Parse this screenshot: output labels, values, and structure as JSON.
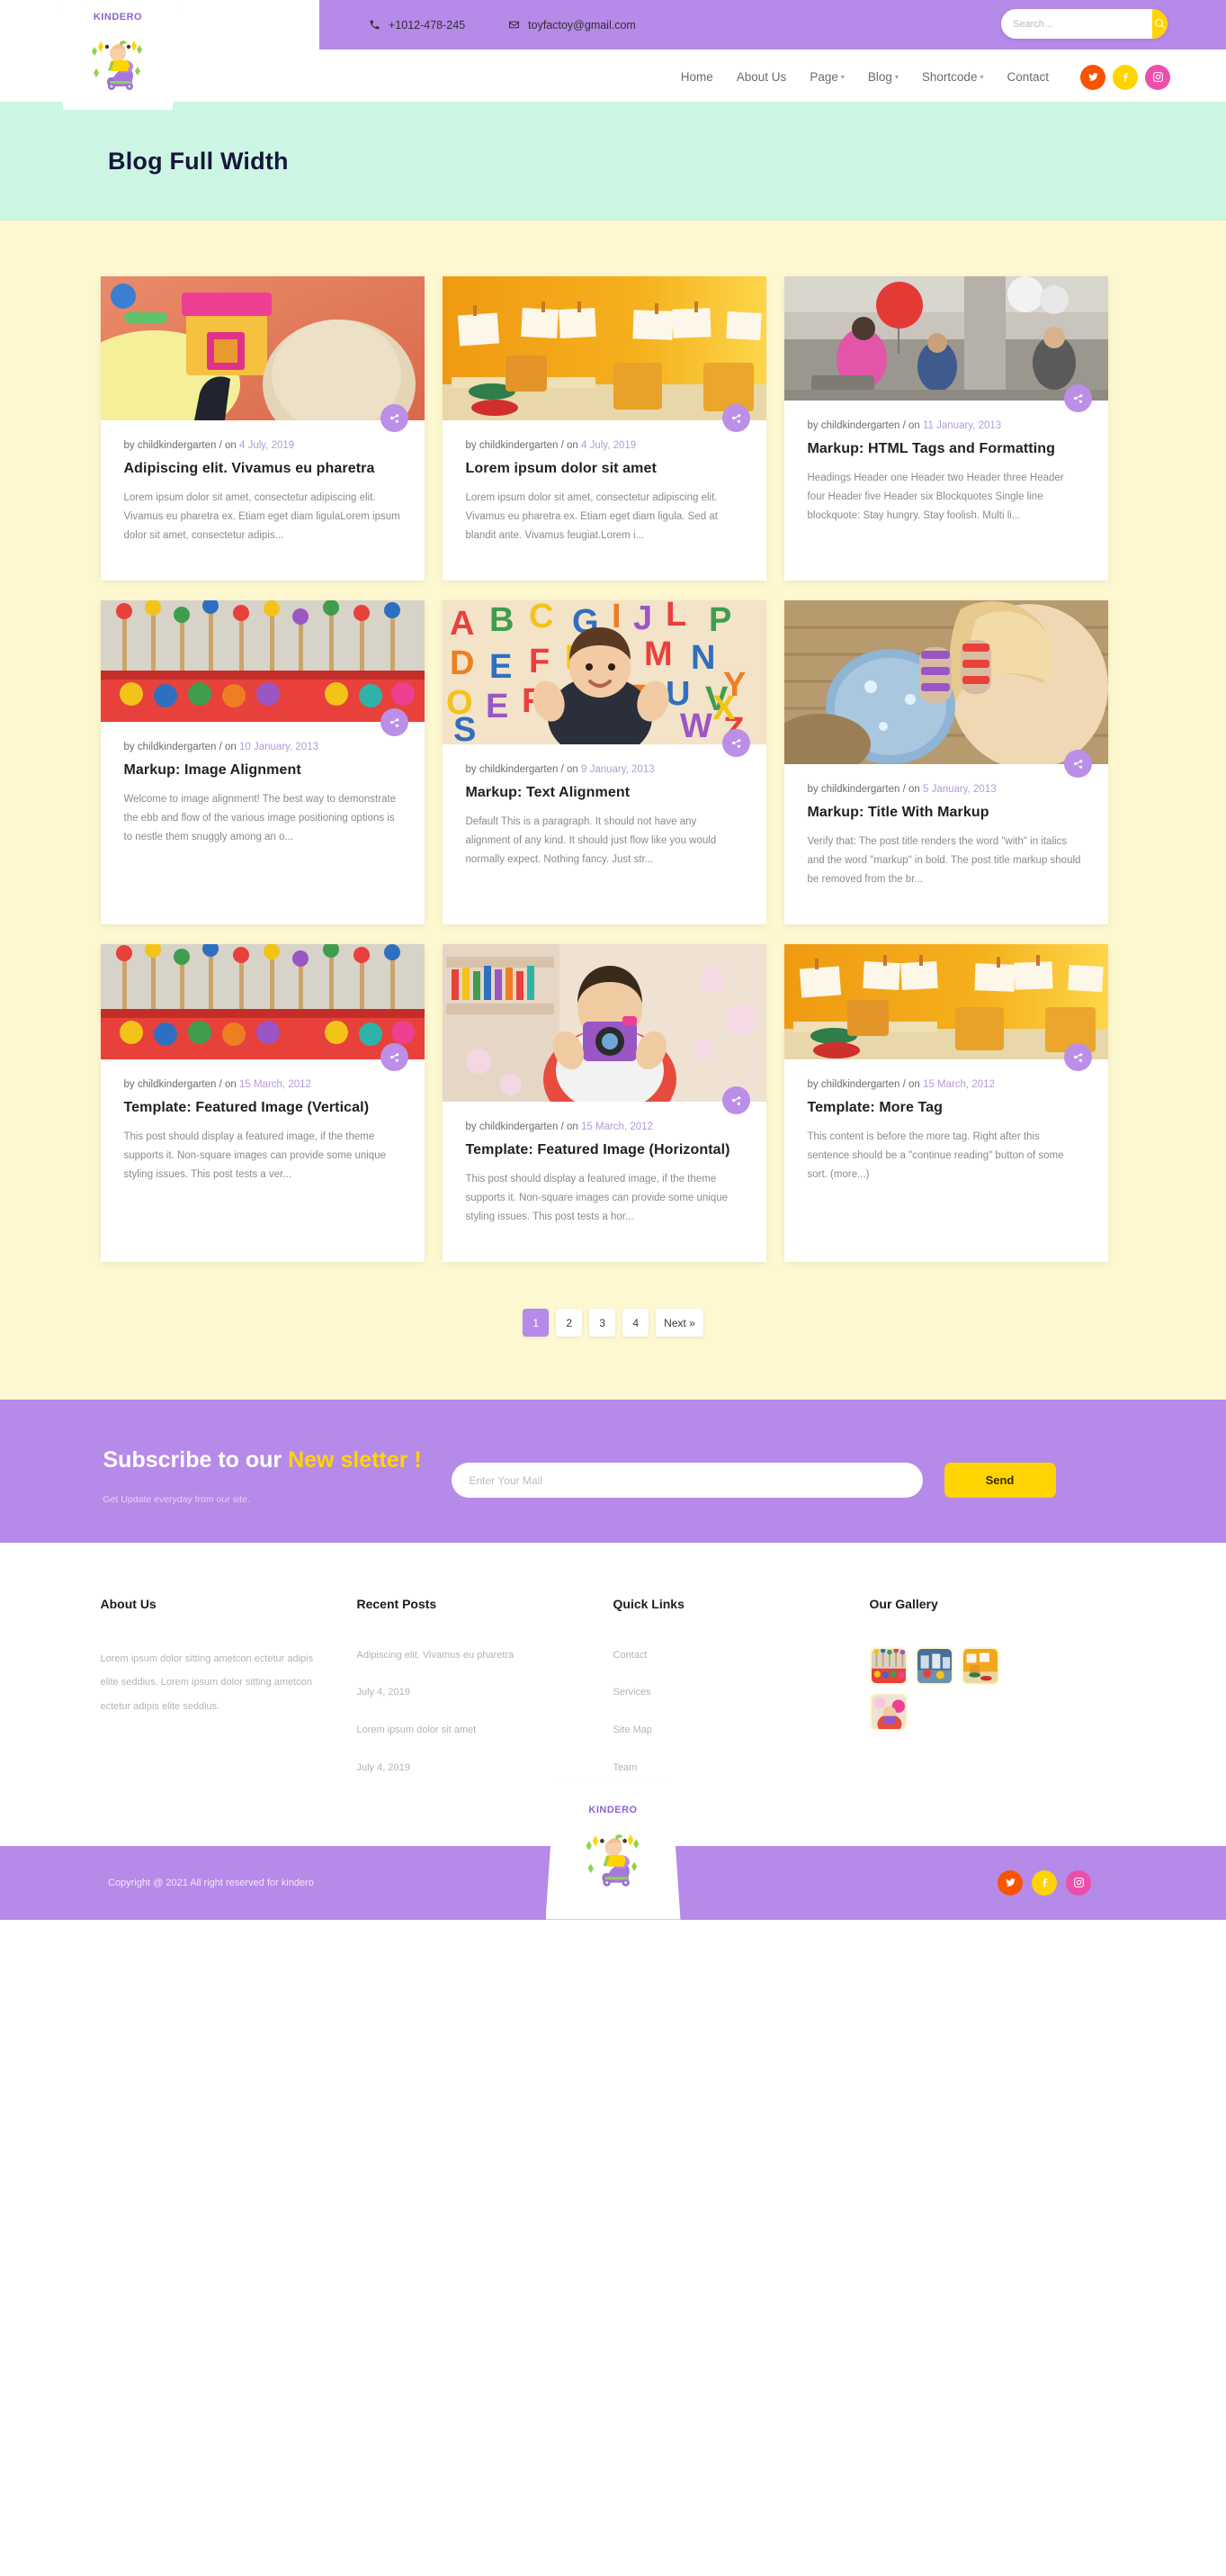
{
  "topbar": {
    "phone": "+1012-478-245",
    "email": "toyfactoy@gmail.com",
    "search_placeholder": "Search...",
    "search_value": "",
    "phone_icon": "phone-icon",
    "email_icon": "envelope-icon",
    "search_icon": "search-icon"
  },
  "brand": {
    "name": "KINDERO"
  },
  "nav": {
    "items": [
      {
        "label": "Home",
        "has_dropdown": false
      },
      {
        "label": "About Us",
        "has_dropdown": false
      },
      {
        "label": "Page",
        "has_dropdown": true
      },
      {
        "label": "Blog",
        "has_dropdown": true
      },
      {
        "label": "Shortcode",
        "has_dropdown": true
      },
      {
        "label": "Contact",
        "has_dropdown": false
      }
    ],
    "socials": [
      {
        "name": "twitter",
        "color": "#f85400"
      },
      {
        "name": "facebook",
        "color": "#ffd400"
      },
      {
        "name": "instagram",
        "color": "#ed4eab"
      }
    ]
  },
  "hero": {
    "title": "Blog Full Width",
    "bg": "#cdf5e4"
  },
  "posts": [
    {
      "author": "by childkindergarten / on ",
      "date": "4 July, 2019",
      "title": "Adipiscing elit. Vivamus eu pharetra",
      "excerpt": "Lorem ipsum dolor sit amet, consectetur adipiscing elit. Vivamus eu pharetra ex. Etiam eget diam ligulaLorem ipsum dolor sit amet, consectetur adipis...",
      "image": "child-with-toy-house"
    },
    {
      "author": "by childkindergarten / on ",
      "date": "4 July, 2019",
      "title": "Lorem ipsum dolor sit amet",
      "excerpt": "Lorem ipsum dolor sit amet, consectetur adipiscing elit. Vivamus eu pharetra ex. Etiam eget diam ligula. Sed at blandit ante. Vivamus feugiat.Lorem i...",
      "image": "classroom-orange-wall"
    },
    {
      "author": "by childkindergarten / on ",
      "date": "11 January, 2013",
      "title": "Markup: HTML Tags and Formatting",
      "excerpt": "Headings Header one Header two Header three Header four Header five Header six Blockquotes Single line blockquote: Stay hungry. Stay foolish. Multi li...",
      "image": "kids-playground-balloon"
    },
    {
      "author": "by childkindergarten / on ",
      "date": "10 January, 2013",
      "title": "Markup: Image Alignment",
      "excerpt": "Welcome to image alignment! The best way to demonstrate the ebb and flow of the various image positioning options is to nestle them snuggly among an o...",
      "image": "paint-brushes-tray"
    },
    {
      "author": "by childkindergarten / on ",
      "date": "9 January, 2013",
      "title": "Markup: Text Alignment",
      "excerpt": "Default This is a paragraph. It should not have any alignment of any kind. It should just flow like you would normally expect. Nothing fancy. Just str...",
      "image": "girl-with-alphabet-letters"
    },
    {
      "author": "by childkindergarten / on ",
      "date": "5 January, 2013",
      "title": "Markup: Title With Markup",
      "excerpt": "Verify that: The post title renders the word \"with\" in italics and the word \"markup\" in bold. The post title markup should be removed from the br...",
      "image": "girl-with-socks-on-hands"
    },
    {
      "author": "by childkindergarten / on ",
      "date": "15 March, 2012",
      "title": "Template: Featured Image (Vertical)",
      "excerpt": "This post should display a featured image, if the theme supports it. Non-square images can provide some unique styling issues. This post tests a ver...",
      "image": "paint-brushes-tray"
    },
    {
      "author": "by childkindergarten / on ",
      "date": "15 March, 2012",
      "title": "Template: Featured Image (Horizontal)",
      "excerpt": "This post should display a featured image, if the theme supports it. Non-square images can provide some unique styling issues. This post tests a hor...",
      "image": "girl-with-camera"
    },
    {
      "author": "by childkindergarten / on ",
      "date": "15 March, 2012",
      "title": "Template: More Tag",
      "excerpt": "This content is before the more tag. Right after this sentence should be a \"continue reading\" button of some sort. (more...)",
      "image": "classroom-orange-wall"
    }
  ],
  "pagination": {
    "pages": [
      "1",
      "2",
      "3",
      "4"
    ],
    "next_label": "Next »",
    "active": "1"
  },
  "newsletter": {
    "title_plain": "Subscribe to our ",
    "title_accent": "New sletter !",
    "subtitle": "Get Update everyday from our site.",
    "input_placeholder": "Enter Your Mail",
    "input_value": "",
    "send_label": "Send",
    "accent_color": "#ffd400",
    "bg": "#b68ae8"
  },
  "footer": {
    "about": {
      "heading": "About Us",
      "text": "Lorem ipsum dolor sitting ametcon ectetur adipis elite seddius. Lorem ipsum dolor sitting ametcon ectetur adipis elite seddius."
    },
    "recent": {
      "heading": "Recent Posts",
      "items": [
        {
          "title": "Adipiscing elit. Vivamus eu pharetra",
          "date": "July 4, 2019"
        },
        {
          "title": "Lorem ipsum dolor sit amet",
          "date": "July 4, 2019"
        }
      ]
    },
    "quick": {
      "heading": "Quick Links",
      "items": [
        "Contact",
        "Services",
        "Site Map",
        "Team"
      ]
    },
    "gallery": {
      "heading": "Our Gallery",
      "items": [
        "paint-brushes-tray",
        "classroom-blue",
        "classroom-orange",
        "kids-pink"
      ]
    },
    "copyright": "Copyright @ 2021 All right reserved for kindero",
    "socials": [
      {
        "name": "twitter",
        "color": "#f85400"
      },
      {
        "name": "facebook",
        "color": "#ffd400"
      },
      {
        "name": "instagram",
        "color": "#ed4eab"
      }
    ]
  }
}
